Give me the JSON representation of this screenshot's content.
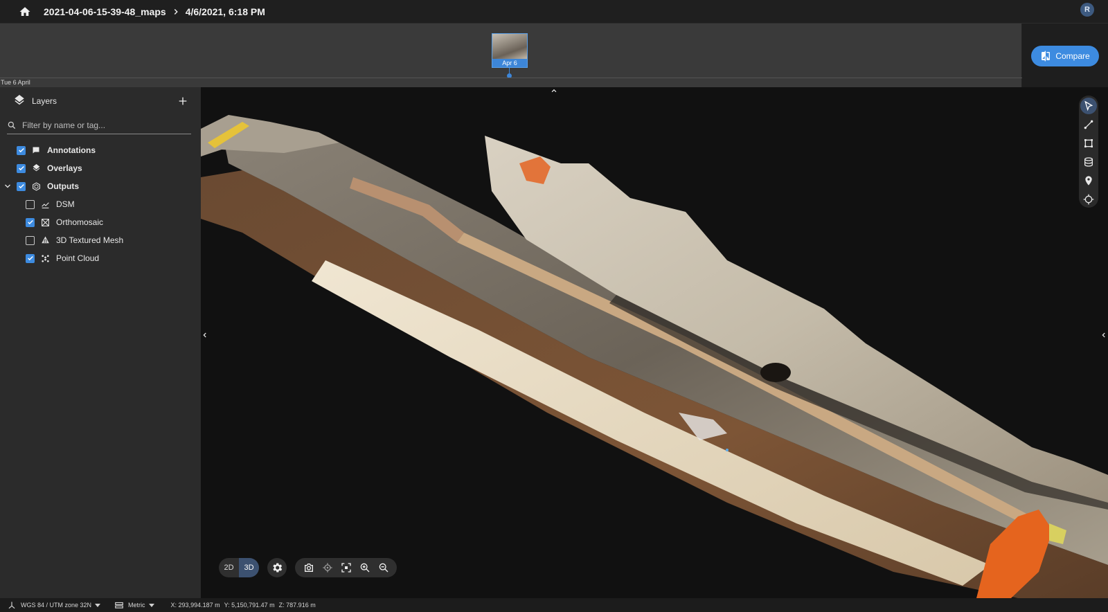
{
  "topbar": {
    "breadcrumb_project": "2021-04-06-15-39-48_maps",
    "breadcrumb_date": "4/6/2021, 6:18 PM",
    "avatar_initial": "R",
    "icons": {
      "home": "home-icon",
      "separator": "chevron-right-icon"
    }
  },
  "timeline": {
    "date_label": "Tue 6 April",
    "thumbnail_label": "Apr 6",
    "compare_label": "Compare"
  },
  "sidebar": {
    "title": "Layers",
    "filter_placeholder": "Filter by name or tag...",
    "layers": [
      {
        "label": "Annotations",
        "checked": true,
        "icon": "annotation-icon"
      },
      {
        "label": "Overlays",
        "checked": true,
        "icon": "layers-icon"
      },
      {
        "label": "Outputs",
        "checked": true,
        "icon": "outputs-icon",
        "expanded": true
      },
      {
        "label": "DSM",
        "checked": false,
        "icon": "dsm-icon"
      },
      {
        "label": "Orthomosaic",
        "checked": true,
        "icon": "orthomosaic-icon"
      },
      {
        "label": "3D Textured Mesh",
        "checked": false,
        "icon": "mesh-icon"
      },
      {
        "label": "Point Cloud",
        "checked": true,
        "icon": "point-cloud-icon"
      }
    ]
  },
  "viewer": {
    "mode_buttons": [
      "2D",
      "3D"
    ],
    "active_mode": "3D",
    "tools": [
      "select-tool",
      "line-tool",
      "area-tool",
      "volume-tool",
      "marker-tool",
      "locate-tool"
    ],
    "active_tool": "select-tool",
    "accent_color": "#3d8be0"
  },
  "status": {
    "crs": "WGS 84 / UTM zone 32N",
    "units": "Metric",
    "x": "X: 293,994.187 m",
    "y": "Y: 5,150,791.47 m",
    "z": "Z: 787.916 m"
  }
}
